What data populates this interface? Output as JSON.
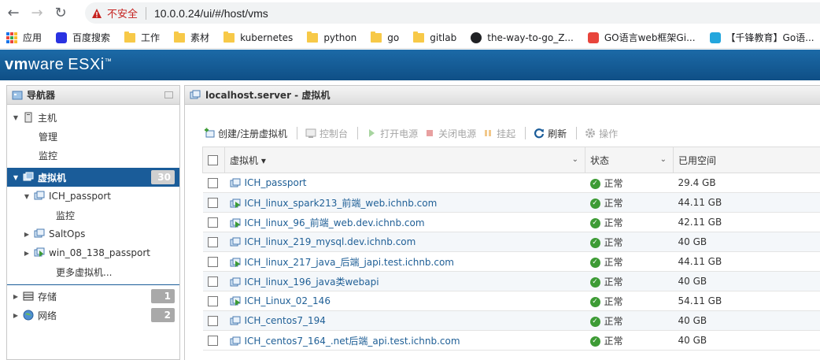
{
  "browser": {
    "security_label": "不安全",
    "url": "10.0.0.24/ui/#/host/vms",
    "bookmarks": [
      {
        "label": "应用",
        "icon": "apps-grid-icon"
      },
      {
        "label": "百度搜索",
        "icon": "baidu-paw-icon"
      },
      {
        "label": "工作",
        "icon": "folder-icon"
      },
      {
        "label": "素材",
        "icon": "folder-icon"
      },
      {
        "label": "kubernetes",
        "icon": "folder-icon"
      },
      {
        "label": "python",
        "icon": "folder-icon"
      },
      {
        "label": "go",
        "icon": "folder-icon"
      },
      {
        "label": "gitlab",
        "icon": "folder-icon"
      },
      {
        "label": "the-way-to-go_Z...",
        "icon": "github-icon"
      },
      {
        "label": "GO语言web框架Gi...",
        "icon": "csdn-icon"
      },
      {
        "label": "【千锋教育】Go语...",
        "icon": "bilibili-icon"
      }
    ]
  },
  "header": {
    "brand_vm": "vm",
    "brand_ware": "ware",
    "brand_product": "ESXi",
    "brand_tm": "™"
  },
  "navigator": {
    "title": "导航器",
    "host": {
      "label": "主机",
      "children": [
        "管理",
        "监控"
      ]
    },
    "vms": {
      "label": "虚拟机",
      "count": "30"
    },
    "vm_tree": [
      {
        "label": "ICH_passport",
        "expanded": true,
        "children": [
          "监控"
        ]
      },
      {
        "label": "SaltOps",
        "expanded": false
      },
      {
        "label": "win_08_138_passport",
        "expanded": false
      }
    ],
    "more": "更多虚拟机...",
    "storage": {
      "label": "存储",
      "count": "1"
    },
    "network": {
      "label": "网络",
      "count": "2"
    }
  },
  "main": {
    "title": "localhost.server - 虚拟机",
    "toolbar": {
      "create": "创建/注册虚拟机",
      "console": "控制台",
      "power_on": "打开电源",
      "power_off": "关闭电源",
      "suspend": "挂起",
      "refresh": "刷新",
      "actions": "操作"
    },
    "columns": {
      "vm": "虚拟机 ▾",
      "status": "状态",
      "space": "已用空间"
    },
    "rows": [
      {
        "name": "ICH_passport",
        "status": "正常",
        "space": "29.4 GB",
        "powered": false
      },
      {
        "name": "ICH_linux_spark213_前端_web.ichnb.com",
        "status": "正常",
        "space": "44.11 GB",
        "powered": true
      },
      {
        "name": "ICH_linux_96_前端_web.dev.ichnb.com",
        "status": "正常",
        "space": "42.11 GB",
        "powered": true
      },
      {
        "name": "ICH_linux_219_mysql.dev.ichnb.com",
        "status": "正常",
        "space": "40 GB",
        "powered": false
      },
      {
        "name": "ICH_linux_217_java_后端_japi.test.ichnb.com",
        "status": "正常",
        "space": "44.11 GB",
        "powered": true
      },
      {
        "name": "ICH_linux_196_java类webapi",
        "status": "正常",
        "space": "40 GB",
        "powered": false
      },
      {
        "name": "ICH_Linux_02_146",
        "status": "正常",
        "space": "54.11 GB",
        "powered": true
      },
      {
        "name": "ICH_centos7_194",
        "status": "正常",
        "space": "40 GB",
        "powered": false
      },
      {
        "name": "ICH_centos7_164_.net后端_api.test.ichnb.com",
        "status": "正常",
        "space": "40 GB",
        "powered": false
      }
    ]
  },
  "colors": {
    "accent": "#1a5c99",
    "ok_green": "#3d9b35",
    "header_blue": "#1c6aa7"
  }
}
